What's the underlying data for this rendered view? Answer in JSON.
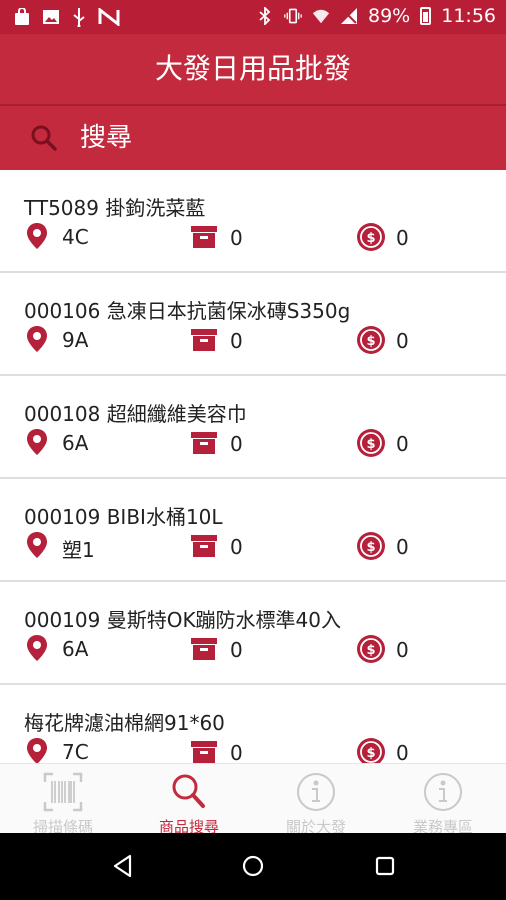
{
  "status_bar": {
    "battery": "89%",
    "time": "11:56"
  },
  "app": {
    "title": "大發日用品批發"
  },
  "search": {
    "label": "搜尋"
  },
  "products": [
    {
      "name": "TT5089 掛鉤洗菜藍",
      "location": "4C",
      "stock": "0",
      "price": "0"
    },
    {
      "name": "000106 急凍日本抗菌保冰磚S350g",
      "location": "9A",
      "stock": "0",
      "price": "0"
    },
    {
      "name": "000108 超細纖維美容巾",
      "location": "6A",
      "stock": "0",
      "price": "0"
    },
    {
      "name": "000109 BIBI水桶10L",
      "location": "塑1",
      "stock": "0",
      "price": "0"
    },
    {
      "name": "000109 曼斯特OK蹦防水標準40入",
      "location": "6A",
      "stock": "0",
      "price": "0"
    },
    {
      "name": "梅花牌濾油棉網91*60",
      "location": "7C",
      "stock": "0",
      "price": "0"
    }
  ],
  "tabs": [
    {
      "label": "掃描條碼",
      "icon": "barcode-icon",
      "active": false
    },
    {
      "label": "商品搜尋",
      "icon": "search-icon",
      "active": true
    },
    {
      "label": "關於大發",
      "icon": "info-icon",
      "active": false
    },
    {
      "label": "業務專區",
      "icon": "info-icon",
      "active": false
    }
  ],
  "colors": {
    "primary": "#c42a3e",
    "status_bar": "#b81f37",
    "icon_red": "#b5203a",
    "inactive_tab": "#c9c9c9"
  }
}
